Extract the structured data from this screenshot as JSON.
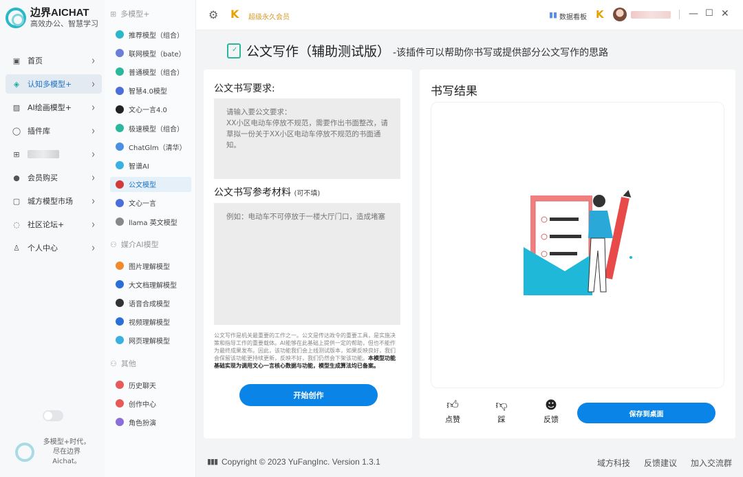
{
  "brand": {
    "title": "边界AICHAT",
    "subtitle": "高效办公、智慧学习"
  },
  "nav": [
    {
      "label": "首页",
      "icon": "home-icon",
      "glyph": "▣"
    },
    {
      "label": "认知多模型+",
      "icon": "cube-icon",
      "glyph": "◈",
      "active": true
    },
    {
      "label": "AI绘画模型+",
      "icon": "image-icon",
      "glyph": "▨"
    },
    {
      "label": "插件库",
      "icon": "bubble-icon",
      "glyph": "◯"
    },
    {
      "label": "",
      "icon": "gift-icon",
      "glyph": "⊞",
      "blurred": true
    },
    {
      "label": "会员购买",
      "icon": "user-icon",
      "glyph": "●"
    },
    {
      "label": "城方模型市场",
      "icon": "store-icon",
      "glyph": "▢"
    },
    {
      "label": "社区论坛+",
      "icon": "chat-icon",
      "glyph": "◌"
    },
    {
      "label": "个人中心",
      "icon": "person-icon",
      "glyph": "♙"
    }
  ],
  "side_footer": "多模型+时代，尽在边界Aichat。",
  "model_groups": {
    "multi": "多模型+",
    "media": "媒介AI模型",
    "other": "其他"
  },
  "models_multi": [
    {
      "label": "推荐模型（组合）",
      "color": "#2ab7c8"
    },
    {
      "label": "联网模型（bate）",
      "color": "#6a7fd8"
    },
    {
      "label": "普通模型（组合）",
      "color": "#2ab79c"
    },
    {
      "label": "智慧4.0模型",
      "color": "#4a6fd8"
    },
    {
      "label": "文心一言4.0",
      "color": "#222222"
    },
    {
      "label": "极速模型（组合）",
      "color": "#2ab79c"
    },
    {
      "label": "ChatGlm（清华）",
      "color": "#4a90e2"
    },
    {
      "label": "智谱AI",
      "color": "#3ab0e0"
    },
    {
      "label": "公文模型",
      "color": "#d23a3a",
      "active": true
    },
    {
      "label": "文心一言",
      "color": "#4a6fd8"
    },
    {
      "label": "llama 英文模型",
      "color": "#888888"
    }
  ],
  "models_media": [
    {
      "label": "图片理解模型",
      "color": "#f08a2a"
    },
    {
      "label": "大文档理解模型",
      "color": "#2a6fd8"
    },
    {
      "label": "语音合成模型",
      "color": "#333333"
    },
    {
      "label": "视频理解模型",
      "color": "#2a6fd8"
    },
    {
      "label": "网页理解模型",
      "color": "#3ab0e0"
    }
  ],
  "models_other": [
    {
      "label": "历史聊天",
      "color": "#e85a5a"
    },
    {
      "label": "创作中心",
      "color": "#e85a5a"
    },
    {
      "label": "角色扮演",
      "color": "#8a6fd8"
    }
  ],
  "topbar": {
    "vip": "超级永久会员",
    "stats": "数据看板"
  },
  "header": {
    "title": "公文写作（辅助测试版）",
    "desc": "-该插件可以帮助你书写或提供部分公文写作的思路"
  },
  "form": {
    "req_label": "公文书写要求:",
    "req_placeholder": "请输入要公文要求：\nXX小区电动车停放不规范，需要作出书面整改，请草拟一份关于XX小区电动车停放不规范的书面通知。",
    "ref_label": "公文书写参考材料",
    "ref_optional": "(可不填)",
    "ref_placeholder": "例如：电动车不可停放于一楼大厅门口，造成堵塞",
    "notice": "公文写作是机关最重要的工作之一。公文是传达政令的重要工具，是实施决策和指导工作的重要载体。AI能够在此基础上提供一定的帮助，但也不能作为最终成果发布。因此，该功能我们会上线测试版本，如果反映良好，我们会保留该功能更持续更新，反映不好，我们仍然会下架该功能。",
    "notice_bold": "本模型功能基础实现为调用文心一言核心数据与功能，模型生成算法均已备案。",
    "start": "开始创作"
  },
  "result": {
    "title": "书写结果",
    "like": "点赞",
    "dislike": "踩",
    "feedback": "反馈",
    "save": "保存到桌面"
  },
  "footer": {
    "copyright": "Copyright © 2023 YuFangInc. Version 1.3.1",
    "links": [
      "域方科技",
      "反馈建议",
      "加入交流群"
    ]
  }
}
